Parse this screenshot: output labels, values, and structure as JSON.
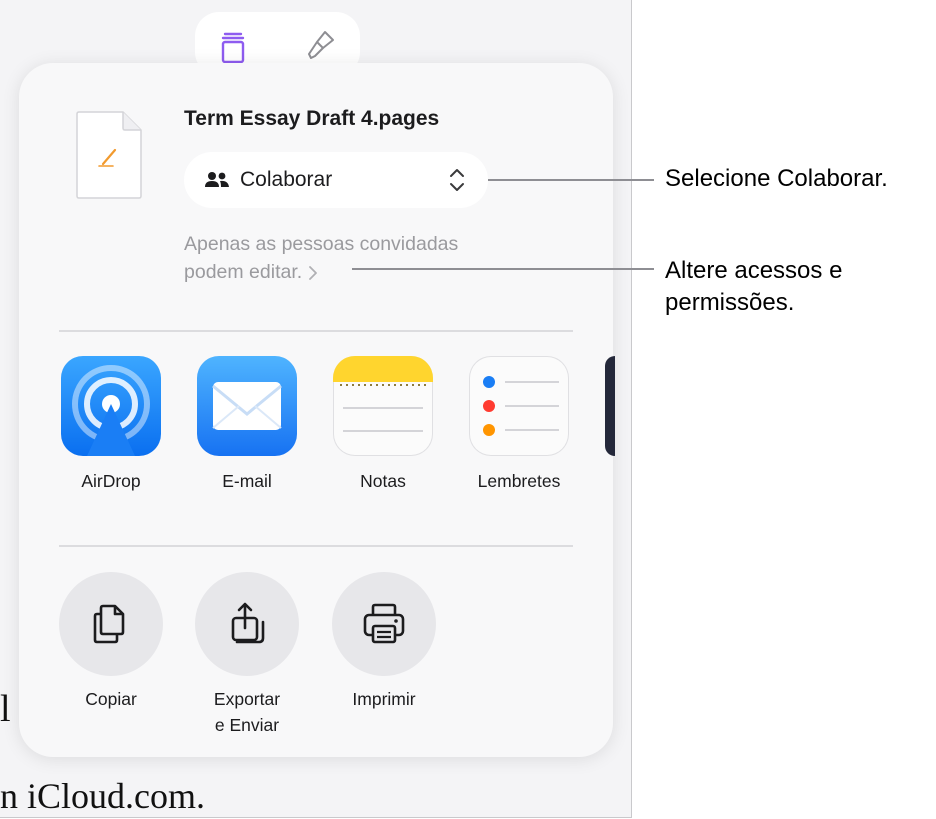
{
  "document": {
    "title": "Term Essay Draft 4.pages"
  },
  "collaborate": {
    "label": "Colaborar"
  },
  "access": {
    "line1": "Apenas as pessoas convidadas",
    "line2": "podem editar."
  },
  "apps": [
    {
      "label": "AirDrop",
      "icon": "airdrop-icon"
    },
    {
      "label": "E-mail",
      "icon": "mail-icon"
    },
    {
      "label": "Notas",
      "icon": "notes-icon"
    },
    {
      "label": "Lembretes",
      "icon": "reminders-icon"
    }
  ],
  "actions": [
    {
      "label": "Copiar",
      "icon": "copy-icon"
    },
    {
      "label_line1": "Exportar",
      "label_line2": "e Enviar",
      "icon": "export-icon"
    },
    {
      "label": "Imprimir",
      "icon": "print-icon"
    }
  ],
  "background": {
    "text1": "l",
    "text2": "n iCloud.com."
  },
  "callouts": {
    "collaborate": "Selecione Colaborar.",
    "access_line1": "Altere acessos e",
    "access_line2": "permissões."
  },
  "colors": {
    "accent_purple": "#8e5cf0",
    "airdrop_blue": "#1a8cff",
    "notes_yellow": "#ffd52e",
    "text_secondary": "#9a9a9e"
  }
}
